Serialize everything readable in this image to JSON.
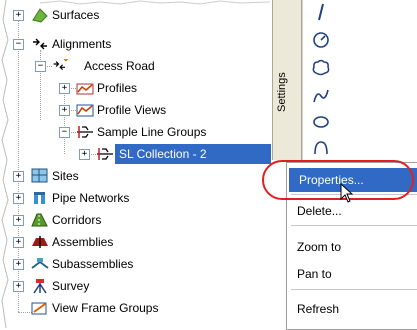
{
  "tree": {
    "surfaces": "Surfaces",
    "alignments": "Alignments",
    "access_road": "Access Road",
    "profiles": "Profiles",
    "profile_views": "Profile Views",
    "sample_line_groups": "Sample Line Groups",
    "sl_collection": "SL Collection - 2",
    "sites": "Sites",
    "pipe_networks": "Pipe Networks",
    "corridors": "Corridors",
    "assemblies": "Assemblies",
    "subassemblies": "Subassemblies",
    "survey": "Survey",
    "view_frame_groups": "View Frame Groups"
  },
  "settings_tab": "Settings",
  "menu": {
    "properties": "Properties...",
    "delete": "Delete...",
    "zoom_to": "Zoom to",
    "pan_to": "Pan to",
    "refresh": "Refresh"
  },
  "colors": {
    "selection": "#316ac5",
    "highlight_ring": "#e02020"
  },
  "icons": [
    "surface-icon",
    "alignment-icon",
    "profile-icon",
    "profile-view-icon",
    "sample-line-icon",
    "site-icon",
    "pipe-network-icon",
    "corridor-icon",
    "assembly-icon",
    "subassembly-icon",
    "survey-icon",
    "view-frame-icon"
  ]
}
